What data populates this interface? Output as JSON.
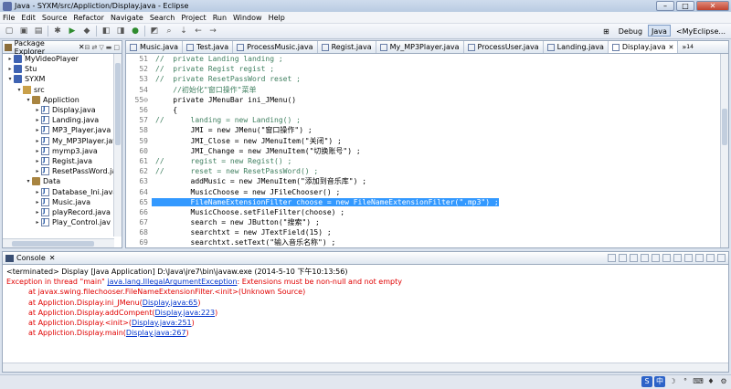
{
  "window": {
    "title": "Java - SYXM/src/Appliction/Display.java - Eclipse",
    "controls": [
      "–",
      "□",
      "✕"
    ]
  },
  "menu": [
    "File",
    "Edit",
    "Source",
    "Refactor",
    "Navigate",
    "Search",
    "Project",
    "Run",
    "Window",
    "Help"
  ],
  "perspectives": {
    "debug": "Debug",
    "java": "Java",
    "other": "<MyEclipse..."
  },
  "package_explorer": {
    "title": "Package Explorer",
    "close": "✕",
    "tree": [
      {
        "label": "MyVideoPlayer",
        "indent": 0,
        "icon": "project",
        "twisty": "▸"
      },
      {
        "label": "Stu",
        "indent": 0,
        "icon": "project",
        "twisty": "▸"
      },
      {
        "label": "SYXM",
        "indent": 0,
        "icon": "project",
        "twisty": "▾"
      },
      {
        "label": "src",
        "indent": 1,
        "icon": "folder",
        "twisty": "▾"
      },
      {
        "label": "Appliction",
        "indent": 2,
        "icon": "package",
        "twisty": "▾"
      },
      {
        "label": "Display.java",
        "indent": 3,
        "icon": "java",
        "twisty": "▸"
      },
      {
        "label": "Landing.java",
        "indent": 3,
        "icon": "java",
        "twisty": "▸"
      },
      {
        "label": "MP3_Player.java",
        "indent": 3,
        "icon": "java",
        "twisty": "▸"
      },
      {
        "label": "My_MP3Player.jav",
        "indent": 3,
        "icon": "java",
        "twisty": "▸"
      },
      {
        "label": "mymp3.java",
        "indent": 3,
        "icon": "java",
        "twisty": "▸"
      },
      {
        "label": "Regist.java",
        "indent": 3,
        "icon": "java",
        "twisty": "▸"
      },
      {
        "label": "ResetPassWord.ja",
        "indent": 3,
        "icon": "java",
        "twisty": "▸"
      },
      {
        "label": "Data",
        "indent": 2,
        "icon": "package",
        "twisty": "▾"
      },
      {
        "label": "Database_Ini.java",
        "indent": 3,
        "icon": "java",
        "twisty": "▸"
      },
      {
        "label": "Music.java",
        "indent": 3,
        "icon": "java",
        "twisty": "▸"
      },
      {
        "label": "playRecord.java",
        "indent": 3,
        "icon": "java",
        "twisty": "▸"
      },
      {
        "label": "Play_Control.jav",
        "indent": 3,
        "icon": "java",
        "twisty": "▸"
      }
    ]
  },
  "editor": {
    "tabs": [
      {
        "label": "Music.java",
        "active": false
      },
      {
        "label": "Test.java",
        "active": false
      },
      {
        "label": "ProcessMusic.java",
        "active": false
      },
      {
        "label": "Regist.java",
        "active": false
      },
      {
        "label": "My_MP3Player.java",
        "active": false
      },
      {
        "label": "ProcessUser.java",
        "active": false
      },
      {
        "label": "Landing.java",
        "active": false
      },
      {
        "label": "Display.java",
        "active": true
      }
    ],
    "overflow_label": "»",
    "overflow_count": "14",
    "lines": [
      {
        "n": "51",
        "text": "//  private Landing landing ;",
        "kind": "comment"
      },
      {
        "n": "52",
        "text": "//  private Regist regist ;",
        "kind": "comment"
      },
      {
        "n": "53",
        "text": "//  private ResetPassWord reset ;",
        "kind": "comment"
      },
      {
        "n": "54",
        "text": "    //初始化\"窗口操作\"菜单",
        "kind": "comment"
      },
      {
        "n": "55⊖",
        "text": "    private JMenuBar ini_JMenu()",
        "kind": "code"
      },
      {
        "n": "56",
        "text": "    {",
        "kind": "code"
      },
      {
        "n": "57",
        "text": "//      landing = new Landing() ;",
        "kind": "comment"
      },
      {
        "n": "58",
        "text": "        JMI = new JMenu(\"窗口操作\") ;",
        "kind": "code"
      },
      {
        "n": "59",
        "text": "        JMI_Close = new JMenuItem(\"关闭\") ;",
        "kind": "code"
      },
      {
        "n": "60",
        "text": "        JMI_Change = new JMenuItem(\"切换账号\") ;",
        "kind": "code"
      },
      {
        "n": "61",
        "text": "//      regist = new Regist() ;",
        "kind": "comment"
      },
      {
        "n": "62",
        "text": "//      reset = new ResetPassWord() ;",
        "kind": "comment"
      },
      {
        "n": "63",
        "text": "        addMusic = new JMenuItem(\"添加到音乐库\") ;",
        "kind": "code"
      },
      {
        "n": "64",
        "text": "        MusicChoose = new JFileChooser() ;",
        "kind": "code"
      },
      {
        "n": "65",
        "text": "        FileNameExtensionFilter choose = new FileNameExtensionFilter(\".mp3\") ;",
        "kind": "highlight"
      },
      {
        "n": "66",
        "text": "        MusicChoose.setFileFilter(choose) ;",
        "kind": "code"
      },
      {
        "n": "67",
        "text": "        search = new JButton(\"搜索\") ;",
        "kind": "code"
      },
      {
        "n": "68",
        "text": "        searchtxt = new JTextField(15) ;",
        "kind": "code"
      },
      {
        "n": "69",
        "text": "        searchtxt.setText(\"输入音乐名称\") ;",
        "kind": "code"
      }
    ]
  },
  "console": {
    "title": "Console",
    "close": "✕",
    "terminated": "<terminated> Display [Java Application] D:\\Java\\jre7\\bin\\javaw.exe (2014-5-10 下午10:13:56)",
    "exception": {
      "prefix": "Exception in thread \"main\" ",
      "type": "java.lang.IllegalArgumentException",
      "message": ": Extensions must be non-null and not empty"
    },
    "stack": [
      {
        "text": "at javax.swing.filechooser.FileNameExtensionFilter.<init>(Unknown Source)",
        "link": ""
      },
      {
        "text": "at Appliction.Display.ini_JMenu(",
        "link": "Display.java:65",
        "suffix": ")"
      },
      {
        "text": "at Appliction.Display.addCompent(",
        "link": "Display.java:223",
        "suffix": ")"
      },
      {
        "text": "at Appliction.Display.<init>(",
        "link": "Display.java:251",
        "suffix": ")"
      },
      {
        "text": "at Appliction.Display.main(",
        "link": "Display.java:267",
        "suffix": ")"
      }
    ]
  },
  "tray": [
    "S",
    "中",
    "☽",
    "°",
    "⌨",
    "♦",
    "⚙"
  ]
}
